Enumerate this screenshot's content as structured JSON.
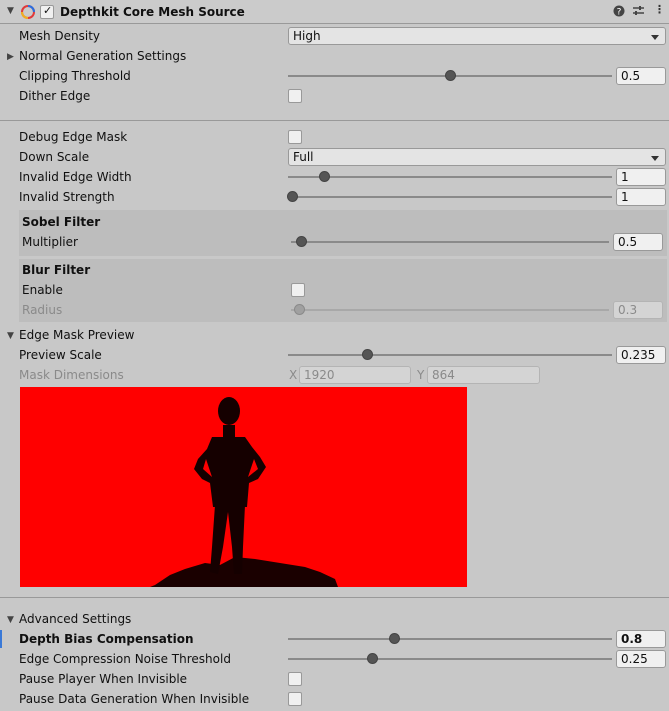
{
  "component": {
    "title": "Depthkit Core Mesh Source",
    "enabled": true
  },
  "fields": {
    "mesh_density": {
      "label": "Mesh Density",
      "value": "High"
    },
    "normal_generation": {
      "label": "Normal Generation Settings"
    },
    "clipping_threshold": {
      "label": "Clipping Threshold",
      "value": "0.5",
      "slider": 0.5
    },
    "dither_edge": {
      "label": "Dither Edge",
      "checked": false
    },
    "debug_edge_mask": {
      "label": "Debug Edge Mask",
      "checked": false
    },
    "down_scale": {
      "label": "Down Scale",
      "value": "Full"
    },
    "invalid_edge_width": {
      "label": "Invalid Edge Width",
      "value": "1",
      "slider": 0.11
    },
    "invalid_strength": {
      "label": "Invalid Strength",
      "value": "1",
      "slider": 0.0
    },
    "sobel_filter": {
      "title": "Sobel Filter",
      "multiplier": {
        "label": "Multiplier",
        "value": "0.5",
        "slider": 0.03
      }
    },
    "blur_filter": {
      "title": "Blur Filter",
      "enable": {
        "label": "Enable",
        "checked": false
      },
      "radius": {
        "label": "Radius",
        "value": "0.3",
        "slider": 0.0
      }
    },
    "edge_mask_preview": {
      "label": "Edge Mask Preview",
      "preview_scale": {
        "label": "Preview Scale",
        "value": "0.235",
        "slider": 0.24
      },
      "mask_dimensions": {
        "label": "Mask Dimensions",
        "x_label": "X",
        "x": "1920",
        "y_label": "Y",
        "y": "864"
      }
    },
    "advanced": {
      "label": "Advanced Settings",
      "depth_bias": {
        "label": "Depth Bias Compensation",
        "value": "0.8",
        "slider": 0.33
      },
      "edge_noise": {
        "label": "Edge Compression Noise Threshold",
        "value": "0.25",
        "slider": 0.26
      },
      "pause_player": {
        "label": "Pause Player When Invisible",
        "checked": false
      },
      "pause_data": {
        "label": "Pause Data Generation When Invisible",
        "checked": false
      }
    }
  },
  "colors": {
    "preview_bg": "#ff0000",
    "accent": "#3a79d7"
  },
  "icons": [
    "foldout-arrow-icon",
    "depthkit-logo-icon",
    "help-icon",
    "preset-icon",
    "more-icon"
  ]
}
